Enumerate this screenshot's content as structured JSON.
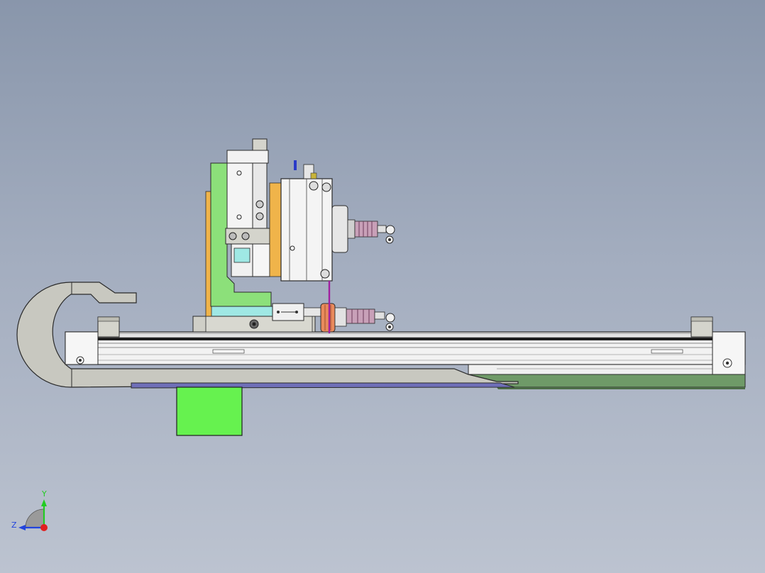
{
  "app": {
    "view": "isometric-cad-viewport"
  },
  "colors": {
    "background_top": "#8996ab",
    "background_bottom": "#bcc3d0",
    "rail_white": "#f2f2f2",
    "part_gray": "#c8c8c0",
    "bracket_green": "#8ce07a",
    "motor_green": "#66f24f",
    "plate_orange": "#f0b44a",
    "block_cyan": "#9fe8e4",
    "base_green": "#6f9a68",
    "strip_blue": "#6f6fb8",
    "spring_pink": "#c8a0b8",
    "coupling_orange": "#e98a5c",
    "rod_magenta": "#a020a0"
  },
  "triad": {
    "y_label": "Y",
    "z_label": "Z",
    "y_color": "#22cc22",
    "z_color": "#2244dd",
    "origin_color": "#e02020"
  },
  "parts": [
    "cable-chain",
    "linear-rail",
    "rail-end-block-left",
    "rail-end-block-right",
    "carriage-base",
    "vertical-bracket",
    "cylinder-body",
    "spring-upper",
    "spring-lower",
    "coupling",
    "motor-block",
    "base-plate",
    "guide-strip"
  ]
}
